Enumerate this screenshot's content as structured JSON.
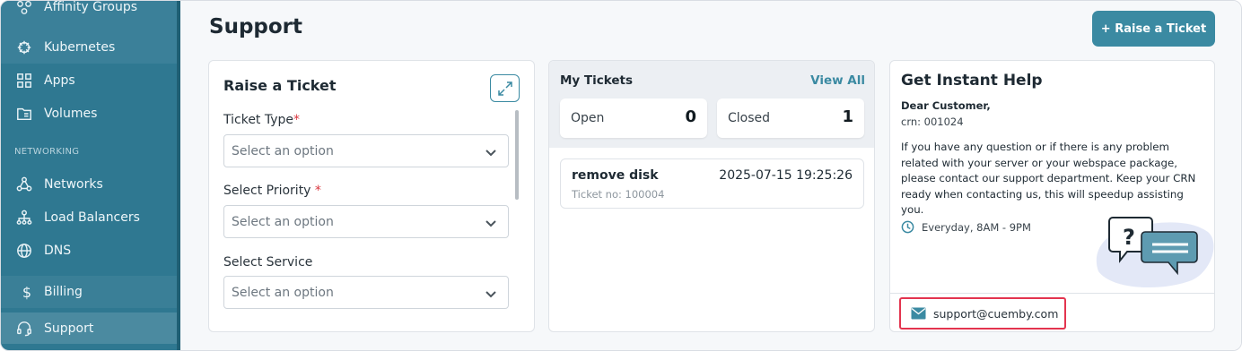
{
  "sidebar": {
    "top_item": "Affinity Groups",
    "items": [
      {
        "label": "Kubernetes",
        "icon": "helm-icon"
      },
      {
        "label": "Apps",
        "icon": "grid-icon"
      },
      {
        "label": "Volumes",
        "icon": "folder-icon"
      }
    ],
    "networking_section": "NETWORKING",
    "net_items": [
      {
        "label": "Networks",
        "icon": "network-icon"
      },
      {
        "label": "Load Balancers",
        "icon": "hierarchy-icon"
      },
      {
        "label": "DNS",
        "icon": "globe-icon"
      }
    ],
    "billing": {
      "label": "Billing",
      "icon": "dollar-icon"
    },
    "support": {
      "label": "Support",
      "icon": "headset-icon"
    }
  },
  "header": {
    "title": "Support",
    "raise_button": "+ Raise a Ticket"
  },
  "raise_ticket": {
    "title": "Raise a Ticket",
    "fields": [
      {
        "label": "Ticket Type",
        "required_mark": "*",
        "placeholder": "Select an option"
      },
      {
        "label": "Select Priority ",
        "required_mark": "*",
        "placeholder": "Select an option"
      },
      {
        "label": "Select Service",
        "required_mark": "",
        "placeholder": "Select an option"
      }
    ]
  },
  "my_tickets": {
    "title": "My Tickets",
    "view_all": "View All",
    "open_label": "Open",
    "open_count": "0",
    "closed_label": "Closed",
    "closed_count": "1",
    "tickets": [
      {
        "name": "remove disk",
        "date": "2025-07-15 19:25:26",
        "number": "Ticket no: 100004"
      }
    ]
  },
  "help": {
    "title": "Get Instant Help",
    "greeting": "Dear Customer,",
    "crn": "crn: 001024",
    "body": "If you have any question or if there is any problem related with your server or your webspace package, please contact our support department. Keep your CRN ready when contacting us, this will speedup assisting you.",
    "hours": "Everyday, 8AM - 9PM",
    "email": "support@cuemby.com"
  },
  "colors": {
    "sidebar": "#2f7891",
    "accent": "#3b8aa2",
    "highlight": "#e3344f"
  }
}
